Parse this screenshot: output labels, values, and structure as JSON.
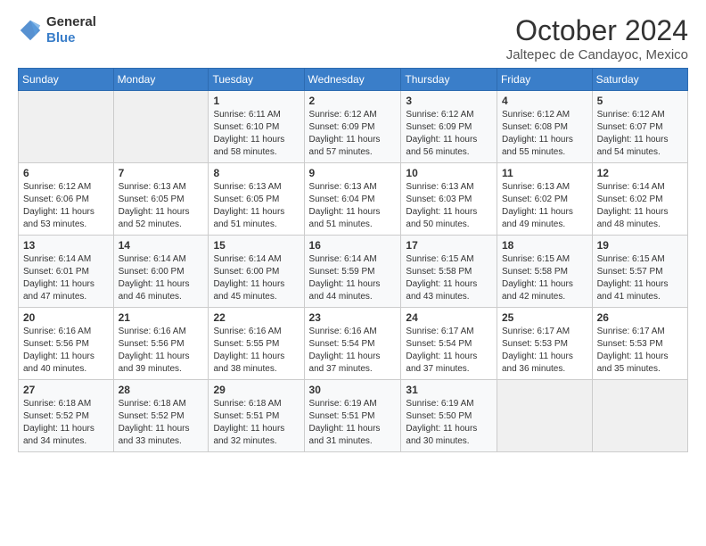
{
  "header": {
    "logo_line1": "General",
    "logo_line2": "Blue",
    "month": "October 2024",
    "location": "Jaltepec de Candayoc, Mexico"
  },
  "weekdays": [
    "Sunday",
    "Monday",
    "Tuesday",
    "Wednesday",
    "Thursday",
    "Friday",
    "Saturday"
  ],
  "weeks": [
    [
      {
        "day": "",
        "sunrise": "",
        "sunset": "",
        "daylight": ""
      },
      {
        "day": "",
        "sunrise": "",
        "sunset": "",
        "daylight": ""
      },
      {
        "day": "1",
        "sunrise": "Sunrise: 6:11 AM",
        "sunset": "Sunset: 6:10 PM",
        "daylight": "Daylight: 11 hours and 58 minutes."
      },
      {
        "day": "2",
        "sunrise": "Sunrise: 6:12 AM",
        "sunset": "Sunset: 6:09 PM",
        "daylight": "Daylight: 11 hours and 57 minutes."
      },
      {
        "day": "3",
        "sunrise": "Sunrise: 6:12 AM",
        "sunset": "Sunset: 6:09 PM",
        "daylight": "Daylight: 11 hours and 56 minutes."
      },
      {
        "day": "4",
        "sunrise": "Sunrise: 6:12 AM",
        "sunset": "Sunset: 6:08 PM",
        "daylight": "Daylight: 11 hours and 55 minutes."
      },
      {
        "day": "5",
        "sunrise": "Sunrise: 6:12 AM",
        "sunset": "Sunset: 6:07 PM",
        "daylight": "Daylight: 11 hours and 54 minutes."
      }
    ],
    [
      {
        "day": "6",
        "sunrise": "Sunrise: 6:12 AM",
        "sunset": "Sunset: 6:06 PM",
        "daylight": "Daylight: 11 hours and 53 minutes."
      },
      {
        "day": "7",
        "sunrise": "Sunrise: 6:13 AM",
        "sunset": "Sunset: 6:05 PM",
        "daylight": "Daylight: 11 hours and 52 minutes."
      },
      {
        "day": "8",
        "sunrise": "Sunrise: 6:13 AM",
        "sunset": "Sunset: 6:05 PM",
        "daylight": "Daylight: 11 hours and 51 minutes."
      },
      {
        "day": "9",
        "sunrise": "Sunrise: 6:13 AM",
        "sunset": "Sunset: 6:04 PM",
        "daylight": "Daylight: 11 hours and 51 minutes."
      },
      {
        "day": "10",
        "sunrise": "Sunrise: 6:13 AM",
        "sunset": "Sunset: 6:03 PM",
        "daylight": "Daylight: 11 hours and 50 minutes."
      },
      {
        "day": "11",
        "sunrise": "Sunrise: 6:13 AM",
        "sunset": "Sunset: 6:02 PM",
        "daylight": "Daylight: 11 hours and 49 minutes."
      },
      {
        "day": "12",
        "sunrise": "Sunrise: 6:14 AM",
        "sunset": "Sunset: 6:02 PM",
        "daylight": "Daylight: 11 hours and 48 minutes."
      }
    ],
    [
      {
        "day": "13",
        "sunrise": "Sunrise: 6:14 AM",
        "sunset": "Sunset: 6:01 PM",
        "daylight": "Daylight: 11 hours and 47 minutes."
      },
      {
        "day": "14",
        "sunrise": "Sunrise: 6:14 AM",
        "sunset": "Sunset: 6:00 PM",
        "daylight": "Daylight: 11 hours and 46 minutes."
      },
      {
        "day": "15",
        "sunrise": "Sunrise: 6:14 AM",
        "sunset": "Sunset: 6:00 PM",
        "daylight": "Daylight: 11 hours and 45 minutes."
      },
      {
        "day": "16",
        "sunrise": "Sunrise: 6:14 AM",
        "sunset": "Sunset: 5:59 PM",
        "daylight": "Daylight: 11 hours and 44 minutes."
      },
      {
        "day": "17",
        "sunrise": "Sunrise: 6:15 AM",
        "sunset": "Sunset: 5:58 PM",
        "daylight": "Daylight: 11 hours and 43 minutes."
      },
      {
        "day": "18",
        "sunrise": "Sunrise: 6:15 AM",
        "sunset": "Sunset: 5:58 PM",
        "daylight": "Daylight: 11 hours and 42 minutes."
      },
      {
        "day": "19",
        "sunrise": "Sunrise: 6:15 AM",
        "sunset": "Sunset: 5:57 PM",
        "daylight": "Daylight: 11 hours and 41 minutes."
      }
    ],
    [
      {
        "day": "20",
        "sunrise": "Sunrise: 6:16 AM",
        "sunset": "Sunset: 5:56 PM",
        "daylight": "Daylight: 11 hours and 40 minutes."
      },
      {
        "day": "21",
        "sunrise": "Sunrise: 6:16 AM",
        "sunset": "Sunset: 5:56 PM",
        "daylight": "Daylight: 11 hours and 39 minutes."
      },
      {
        "day": "22",
        "sunrise": "Sunrise: 6:16 AM",
        "sunset": "Sunset: 5:55 PM",
        "daylight": "Daylight: 11 hours and 38 minutes."
      },
      {
        "day": "23",
        "sunrise": "Sunrise: 6:16 AM",
        "sunset": "Sunset: 5:54 PM",
        "daylight": "Daylight: 11 hours and 37 minutes."
      },
      {
        "day": "24",
        "sunrise": "Sunrise: 6:17 AM",
        "sunset": "Sunset: 5:54 PM",
        "daylight": "Daylight: 11 hours and 37 minutes."
      },
      {
        "day": "25",
        "sunrise": "Sunrise: 6:17 AM",
        "sunset": "Sunset: 5:53 PM",
        "daylight": "Daylight: 11 hours and 36 minutes."
      },
      {
        "day": "26",
        "sunrise": "Sunrise: 6:17 AM",
        "sunset": "Sunset: 5:53 PM",
        "daylight": "Daylight: 11 hours and 35 minutes."
      }
    ],
    [
      {
        "day": "27",
        "sunrise": "Sunrise: 6:18 AM",
        "sunset": "Sunset: 5:52 PM",
        "daylight": "Daylight: 11 hours and 34 minutes."
      },
      {
        "day": "28",
        "sunrise": "Sunrise: 6:18 AM",
        "sunset": "Sunset: 5:52 PM",
        "daylight": "Daylight: 11 hours and 33 minutes."
      },
      {
        "day": "29",
        "sunrise": "Sunrise: 6:18 AM",
        "sunset": "Sunset: 5:51 PM",
        "daylight": "Daylight: 11 hours and 32 minutes."
      },
      {
        "day": "30",
        "sunrise": "Sunrise: 6:19 AM",
        "sunset": "Sunset: 5:51 PM",
        "daylight": "Daylight: 11 hours and 31 minutes."
      },
      {
        "day": "31",
        "sunrise": "Sunrise: 6:19 AM",
        "sunset": "Sunset: 5:50 PM",
        "daylight": "Daylight: 11 hours and 30 minutes."
      },
      {
        "day": "",
        "sunrise": "",
        "sunset": "",
        "daylight": ""
      },
      {
        "day": "",
        "sunrise": "",
        "sunset": "",
        "daylight": ""
      }
    ]
  ]
}
